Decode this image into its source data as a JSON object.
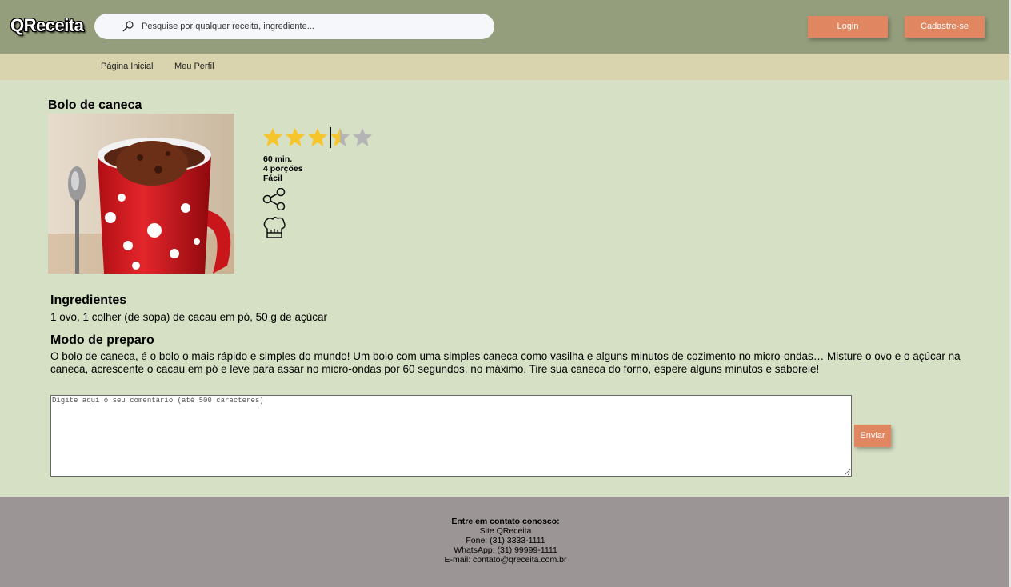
{
  "app": {
    "logo_text": "QReceita"
  },
  "search": {
    "placeholder": "Pesquise por qualquer receita, ingrediente..."
  },
  "header": {
    "login_label": "Login",
    "signup_label": "Cadastre-se"
  },
  "nav": {
    "items": [
      {
        "label": "Página Inicial"
      },
      {
        "label": "Meu Perfil"
      }
    ]
  },
  "recipe": {
    "title": "Bolo de caneca",
    "rating": {
      "value": 3.5,
      "max": 5
    },
    "time": "60 min.",
    "servings": "4 porções",
    "difficulty": "Fácil",
    "ingredients_heading": "Ingredientes",
    "ingredients_text": "1 ovo, 1 colher (de sopa) de cacau em pó, 50 g de açúcar",
    "method_heading": "Modo de preparo",
    "method_text": "O bolo de caneca, é o bolo o mais rápido e simples do mundo! Um bolo com uma simples caneca como vasilha e alguns minutos de cozimento no micro-ondas… Misture o ovo e o açúcar na caneca, acrescente o cacau em pó e leve para assar no micro-ondas por 60 segundos, no máximo. Tire sua caneca do forno, espere alguns minutos e saboreie!"
  },
  "comment": {
    "placeholder": "Digite aqui o seu comentário (até 500 caracteres)",
    "send_label": "Enviar"
  },
  "footer": {
    "heading": "Entre em contato conosco:",
    "lines": [
      "Site QReceita",
      "Fone: (31) 3333-1111",
      "WhatsApp: (31) 99999-1111",
      "E-mail: contato@qreceita.com.br"
    ]
  },
  "colors": {
    "header": "#949e7c",
    "nav": "#d9d4ae",
    "page": "#d6e0c4",
    "accent": "#e08660",
    "footer": "#9b9595",
    "star": "#f6c52b",
    "star_empty": "#b4b4b4"
  }
}
